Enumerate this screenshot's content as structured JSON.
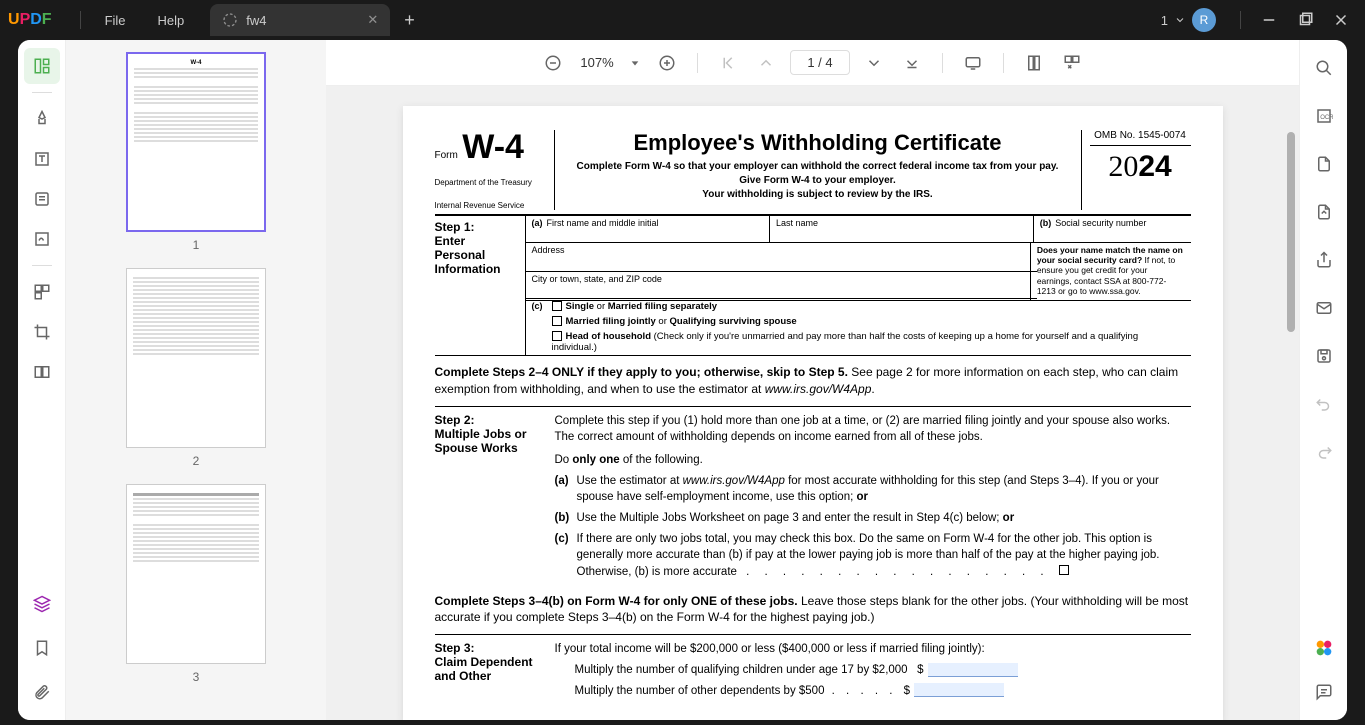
{
  "app": {
    "logo": "UPDF",
    "menu": [
      "File",
      "Help"
    ],
    "tab_name": "fw4",
    "account_count": "1",
    "avatar_letter": "R"
  },
  "toolbar": {
    "zoom": "107%",
    "page": "1 / 4"
  },
  "thumbs": {
    "labels": [
      "1",
      "2",
      "3"
    ]
  },
  "doc": {
    "form_label": "Form",
    "form_code": "W-4",
    "dept1": "Department of the Treasury",
    "dept2": "Internal Revenue Service",
    "title": "Employee's Withholding Certificate",
    "sub1": "Complete Form W-4 so that your employer can withhold the correct federal income tax from your pay.",
    "sub2": "Give Form W-4 to your employer.",
    "sub3": "Your withholding is subject to review by the IRS.",
    "omb": "OMB No. 1545-0074",
    "year_prefix": "20",
    "year_suffix": "24",
    "step1": {
      "label_a": "Step 1:",
      "label_b": "Enter Personal Information",
      "fn": "First name and middle initial",
      "ln": "Last name",
      "ssn": "Social security number",
      "addr": "Address",
      "city": "City or town, state, and ZIP code",
      "match_q": "Does your name match the name on your social security card?",
      "match_a": " If not, to ensure you get credit for your earnings, contact SSA at 800-772-1213 or go to www.ssa.gov.",
      "c1a": "Single",
      "c1b": " or ",
      "c1c": "Married filing separately",
      "c2a": "Married filing jointly",
      "c2b": " or ",
      "c2c": "Qualifying surviving spouse",
      "c3a": "Head of household",
      "c3b": " (Check only if you're unmarried and pay more than half the costs of keeping up a home for yourself and a qualifying individual.)"
    },
    "para1a": "Complete Steps 2–4 ONLY if they apply to you; otherwise, skip to Step 5.",
    "para1b": " See page 2 for more information on each step, who can claim exemption from withholding, and when to use the estimator at ",
    "para1c": "www.irs.gov/W4App",
    "step2": {
      "label_a": "Step 2:",
      "label_b": "Multiple Jobs or Spouse Works",
      "intro": "Complete this step if you (1) hold more than one job at a time, or (2) are married filing jointly and your spouse also works. The correct amount of withholding depends on income earned from all of these jobs.",
      "do_a": "Do ",
      "do_b": "only one",
      "do_c": " of the following.",
      "a": "Use the estimator at ",
      "a_link": "www.irs.gov/W4App",
      "a2": " for most accurate withholding for this step (and Steps 3–4). If you or your spouse have self-employment income, use this option; ",
      "a3": "or",
      "b": "Use the Multiple Jobs Worksheet on page 3 and enter the result in Step 4(c) below; ",
      "b2": "or",
      "c": "If there are only two jobs total, you may check this box. Do the same on Form W-4 for the other job. This option is generally more accurate than (b) if pay at the lower paying job is more than half of the pay at the higher paying job. Otherwise, (b) is more accurate"
    },
    "para2a": "Complete Steps 3–4(b) on Form W-4 for only ONE of these jobs.",
    "para2b": " Leave those steps blank for the other jobs. (Your withholding will be most accurate if you complete Steps 3–4(b) on the Form W-4 for the highest paying job.)",
    "step3": {
      "label_a": "Step 3:",
      "label_b": "Claim Dependent and Other",
      "intro": "If your total income will be $200,000 or less ($400,000 or less if married filing jointly):",
      "line1": "Multiply the number of qualifying children under age 17 by $2,000",
      "line2": "Multiply the number of other dependents by $500",
      "dollar": "$"
    }
  }
}
